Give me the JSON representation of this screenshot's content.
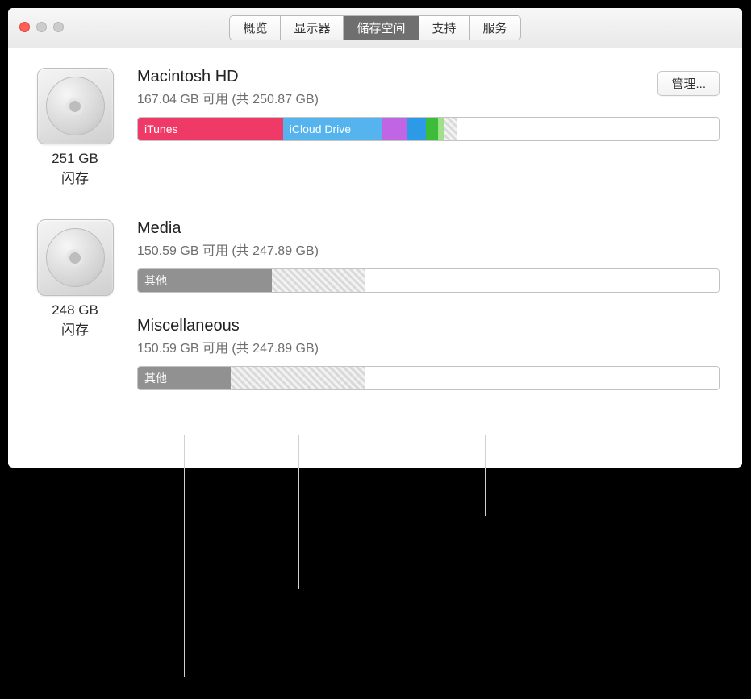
{
  "tabs": {
    "overview": "概览",
    "displays": "显示器",
    "storage": "储存空间",
    "support": "支持",
    "service": "服务"
  },
  "manage_label": "管理...",
  "drives": [
    {
      "size": "251 GB",
      "type": "闪存",
      "volumes": [
        {
          "name": "Macintosh HD",
          "available": "167.04 GB 可用 (共 250.87 GB)",
          "segments": [
            {
              "label": "iTunes",
              "pct": 25.0,
              "color": "#ef3a67"
            },
            {
              "label": "iCloud Drive",
              "pct": 17.0,
              "color": "#55b3ee"
            },
            {
              "label": "",
              "pct": 4.5,
              "color": "#c065e3"
            },
            {
              "label": "",
              "pct": 3.2,
              "color": "#2d9ae8"
            },
            {
              "label": "",
              "pct": 2.0,
              "color": "#3bbd3a"
            },
            {
              "label": "",
              "pct": 1.0,
              "color": "#9fe08b"
            },
            {
              "label": "",
              "pct": 2.3,
              "kind": "hatch"
            },
            {
              "label": "",
              "pct": 45.0,
              "kind": "free"
            }
          ]
        }
      ]
    },
    {
      "size": "248 GB",
      "type": "闪存",
      "volumes": [
        {
          "name": "Media",
          "available": "150.59 GB 可用 (共 247.89 GB)",
          "segments": [
            {
              "label": "其他",
              "pct": 23.0,
              "kind": "gray"
            },
            {
              "label": "",
              "pct": 16.0,
              "kind": "hatch"
            },
            {
              "label": "",
              "pct": 61.0,
              "kind": "free"
            }
          ]
        },
        {
          "name": "Miscellaneous",
          "available": "150.59 GB 可用 (共 247.89 GB)",
          "segments": [
            {
              "label": "其他",
              "pct": 16.0,
              "kind": "gray"
            },
            {
              "label": "",
              "pct": 23.0,
              "kind": "hatch"
            },
            {
              "label": "",
              "pct": 61.0,
              "kind": "free"
            }
          ]
        }
      ]
    }
  ]
}
